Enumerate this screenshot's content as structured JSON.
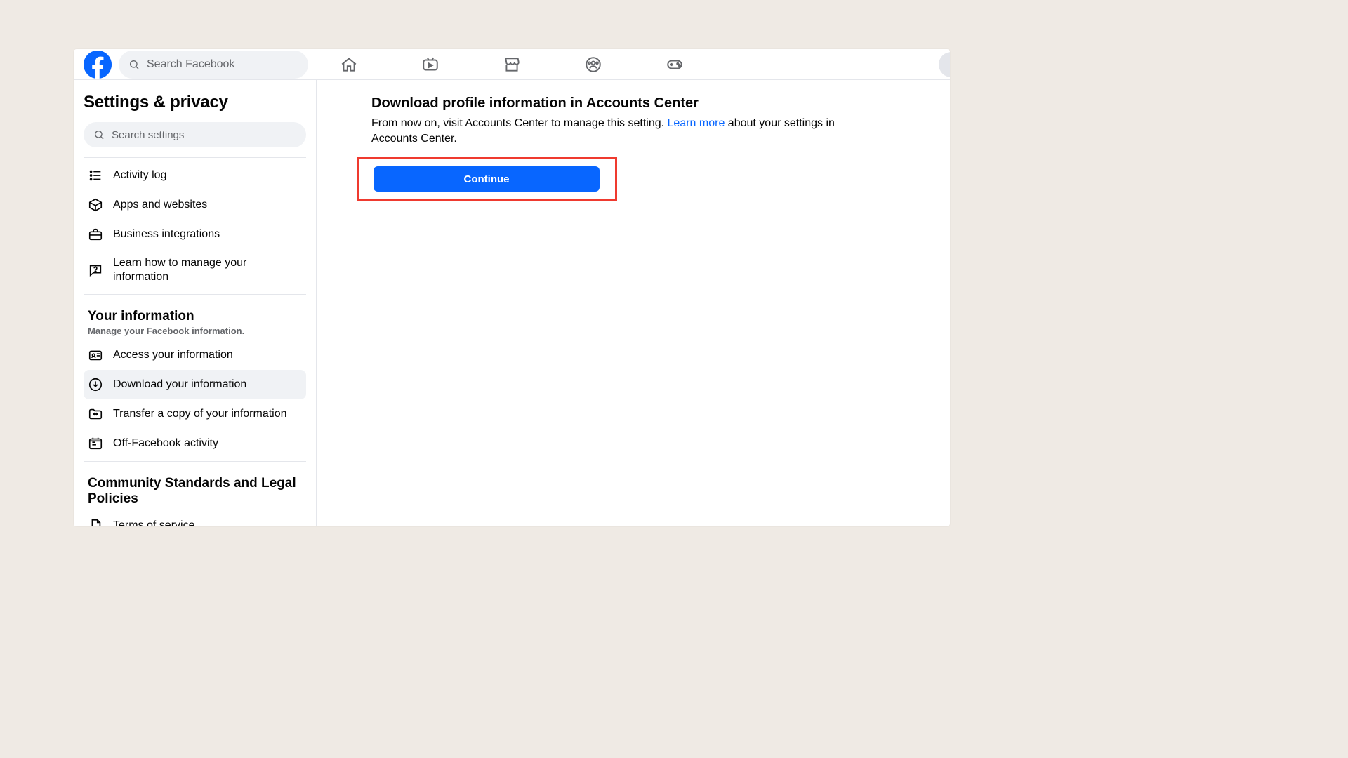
{
  "topbar": {
    "search_placeholder": "Search Facebook"
  },
  "sidebar": {
    "title": "Settings & privacy",
    "search_placeholder": "Search settings",
    "nav_group_1": [
      {
        "label": "Activity log"
      },
      {
        "label": "Apps and websites"
      },
      {
        "label": "Business integrations"
      },
      {
        "label": "Learn how to manage your information"
      }
    ],
    "section_your_info": {
      "title": "Your information",
      "subtitle": "Manage your Facebook information."
    },
    "nav_group_2": [
      {
        "label": "Access your information"
      },
      {
        "label": "Download your information",
        "selected": true
      },
      {
        "label": "Transfer a copy of your information"
      },
      {
        "label": "Off-Facebook activity"
      }
    ],
    "section_community": {
      "title": "Community Standards and Legal Policies"
    },
    "nav_group_3": [
      {
        "label": "Terms of service"
      }
    ]
  },
  "content": {
    "title": "Download profile information in Accounts Center",
    "desc_before": "From now on, visit Accounts Center to manage this setting. ",
    "learn_more": "Learn more",
    "desc_after": " about your settings in Accounts Center.",
    "button": "Continue"
  },
  "colors": {
    "accent": "#0866ff",
    "highlight": "#ef3a2f"
  }
}
